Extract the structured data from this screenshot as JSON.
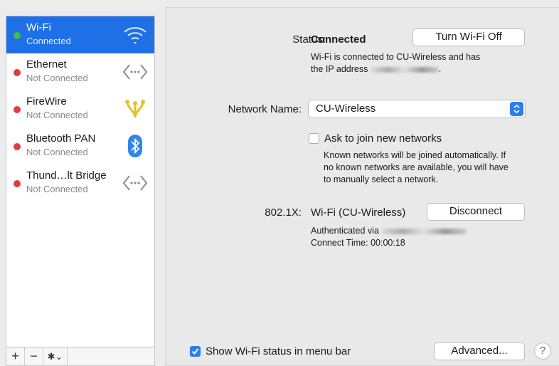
{
  "sidebar": {
    "services": [
      {
        "name": "Wi-Fi",
        "status": "Connected",
        "dot_color": "#3bbf4a",
        "icon": "wifi-icon",
        "selected": true
      },
      {
        "name": "Ethernet",
        "status": "Not Connected",
        "dot_color": "#e53b3b",
        "icon": "ethernet-arrows-icon"
      },
      {
        "name": "FireWire",
        "status": "Not Connected",
        "dot_color": "#e53b3b",
        "icon": "firewire-icon"
      },
      {
        "name": "Bluetooth PAN",
        "status": "Not Connected",
        "dot_color": "#e53b3b",
        "icon": "bluetooth-icon"
      },
      {
        "name": "Thund…lt Bridge",
        "status": "Not Connected",
        "dot_color": "#e53b3b",
        "icon": "thunderbolt-bridge-arrows-icon"
      }
    ],
    "toolbar": {
      "add": "+",
      "remove": "−",
      "gear": "✱⌄"
    }
  },
  "wifi": {
    "status_label": "Status:",
    "status_value": "Connected",
    "turn_off_button": "Turn Wi-Fi Off",
    "status_detail_line1": "Wi-Fi is connected to CU-Wireless and has",
    "status_detail_line2": "the IP address",
    "status_detail_end": ".",
    "network_name_label": "Network Name:",
    "network_name_value": "CU-Wireless",
    "ask_join_label": "Ask to join new networks",
    "ask_join_checked": false,
    "ask_join_help_line1": "Known networks will be joined automatically. If",
    "ask_join_help_line2": "no known networks are available, you will have",
    "ask_join_help_line3": "to manually select a network.",
    "dot1x_label": "802.1X:",
    "dot1x_value": "Wi-Fi (CU-Wireless)",
    "disconnect_button": "Disconnect",
    "authenticated_via": "Authenticated via",
    "connect_time": "Connect Time: 00:00:18"
  },
  "footer": {
    "show_status_label": "Show Wi-Fi status in menu bar",
    "show_status_checked": true,
    "advanced_button": "Advanced...",
    "help_button": "?"
  },
  "colors": {
    "accent": "#1f6fe6",
    "connected": "#3bbf4a",
    "disconnected": "#e53b3b"
  }
}
